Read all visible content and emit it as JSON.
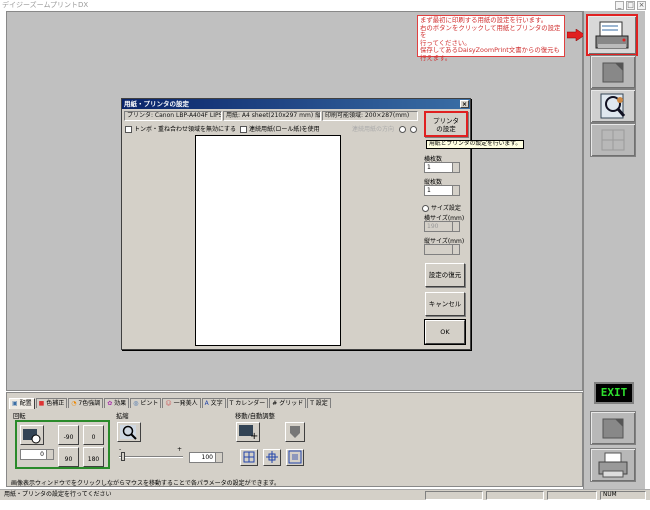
{
  "app": {
    "title": "デイジーズームプリントDX"
  },
  "callout": {
    "lines": [
      "まず最初に印刷する用紙の設定を行います。",
      "右のボタンをクリックして用紙とプリンタの設定を",
      "行ってください。",
      "保存してあるDaisyZoomPrint文書からの復元も",
      "行えます。"
    ]
  },
  "right_panel": {
    "exit_label": "EXIT"
  },
  "dialog": {
    "title": "用紙・プリンタの設定",
    "close": "×",
    "printer_label": "プリンタ: Canon LBP-A404F LIPS",
    "paper_label": "用紙: A4 sheet(210x297 mm) 縦",
    "printable_label": "印刷可能領域: 200×287(mm)",
    "crop_marks_label": "トンボ・重ね合わせ領域を無効にする",
    "continuous_label": "連続用紙(ロール紙)を使用",
    "dim_label": "連続用紙の方向",
    "printer_button": "プリンタ\nの設定",
    "tooltip": "用紙とプリンタの設定を行います。",
    "h_sheets_label": "横枚数",
    "h_sheets_value": "1",
    "v_sheets_label": "縦枚数",
    "v_sheets_value": "1",
    "size_setting_label": "サイズ設定",
    "h_size_label": "横サイズ(mm)",
    "h_size_value": "190",
    "v_size_label": "縦サイズ(mm)",
    "v_size_value": "",
    "restore_button": "設定の復元",
    "cancel_button": "キャンセル",
    "ok_button": "OK"
  },
  "tabs": [
    {
      "label": "配置",
      "icon": "layout-icon"
    },
    {
      "label": "色補正",
      "icon": "color-icon"
    },
    {
      "label": "7色強調",
      "icon": "rainbow-icon"
    },
    {
      "label": "効果",
      "icon": "effect-icon"
    },
    {
      "label": "ピント",
      "icon": "focus-icon"
    },
    {
      "label": "一発美人",
      "icon": "beauty-icon"
    },
    {
      "label": "文字",
      "icon": "text-icon"
    },
    {
      "label": "カレンダー",
      "icon": "calendar-icon"
    },
    {
      "label": "グリッド",
      "icon": "grid-icon"
    },
    {
      "label": "設定",
      "icon": "settings-icon"
    }
  ],
  "layout_panel": {
    "rotate_label": "回転",
    "rotate_left": "-90",
    "rotate_zero": "0",
    "rotate_right": "90",
    "rotate_180": "180",
    "angle_value": "0",
    "zoom_label": "拡縮",
    "zoom_minus": "-",
    "zoom_plus": "+",
    "zoom_value": "100",
    "move_label": "移動/自動調整",
    "hint": "画像表示ウィンドウでをクリックしながらマウスを移動することで各パラメータの設定ができます。"
  },
  "status": {
    "message": "用紙・プリンタの設定を行ってください",
    "num": "NUM"
  },
  "colors": {
    "accent_red": "#e02020",
    "exit_green": "#2ee02e",
    "title_blue": "#0a246a"
  }
}
